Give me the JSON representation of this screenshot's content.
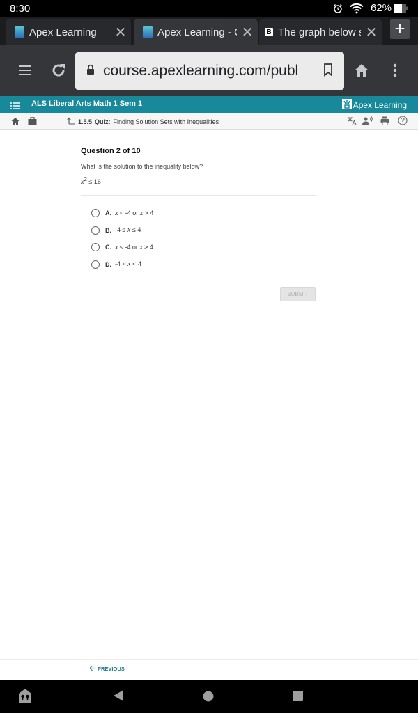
{
  "status_bar": {
    "time": "8:30",
    "battery": "62%",
    "icons": [
      "alarm-icon",
      "wifi-icon",
      "battery-icon"
    ]
  },
  "browser": {
    "tabs": [
      {
        "title": "Apex Learning",
        "favicon": "apex-favicon",
        "active": false
      },
      {
        "title": "Apex Learning - Co",
        "favicon": "apex-favicon",
        "active": true
      },
      {
        "title": "The graph below sh",
        "favicon": "brainly-favicon",
        "favicon_glyph": "B",
        "active": false
      }
    ],
    "new_tab_label": "+",
    "url": "course.apexlearning.com/publ"
  },
  "app_header": {
    "course_title": "ALS Liberal Arts Math 1 Sem 1",
    "brand": "Apex Learning",
    "accent_color": "#17899a"
  },
  "subnav": {
    "section_number": "1.5.5",
    "section_type": "Quiz:",
    "section_title": "Finding Solution Sets with Inequalities",
    "tools": [
      "translate-icon",
      "read-aloud-icon",
      "print-icon",
      "help-icon"
    ]
  },
  "question": {
    "heading": "Question 2 of 10",
    "prompt": "What is the solution to the inequality below?",
    "expression": {
      "var": "x",
      "exp": "2",
      "rest": " ≤ 16"
    },
    "choices": [
      {
        "letter": "A.",
        "parts": [
          {
            "i": "x"
          },
          {
            "t": " < -4 or "
          },
          {
            "i": "x"
          },
          {
            "t": " > 4"
          }
        ]
      },
      {
        "letter": "B.",
        "parts": [
          {
            "t": "-4 ≤ "
          },
          {
            "i": "x"
          },
          {
            "t": " ≤ 4"
          }
        ]
      },
      {
        "letter": "C.",
        "parts": [
          {
            "i": "x"
          },
          {
            "t": " ≤ -4 or "
          },
          {
            "i": "x"
          },
          {
            "t": " ≥ 4"
          }
        ]
      },
      {
        "letter": "D.",
        "parts": [
          {
            "t": "-4 < "
          },
          {
            "i": "x"
          },
          {
            "t": " < 4"
          }
        ]
      }
    ],
    "submit_label": "SUBMIT"
  },
  "footer": {
    "previous_label": "PREVIOUS"
  }
}
